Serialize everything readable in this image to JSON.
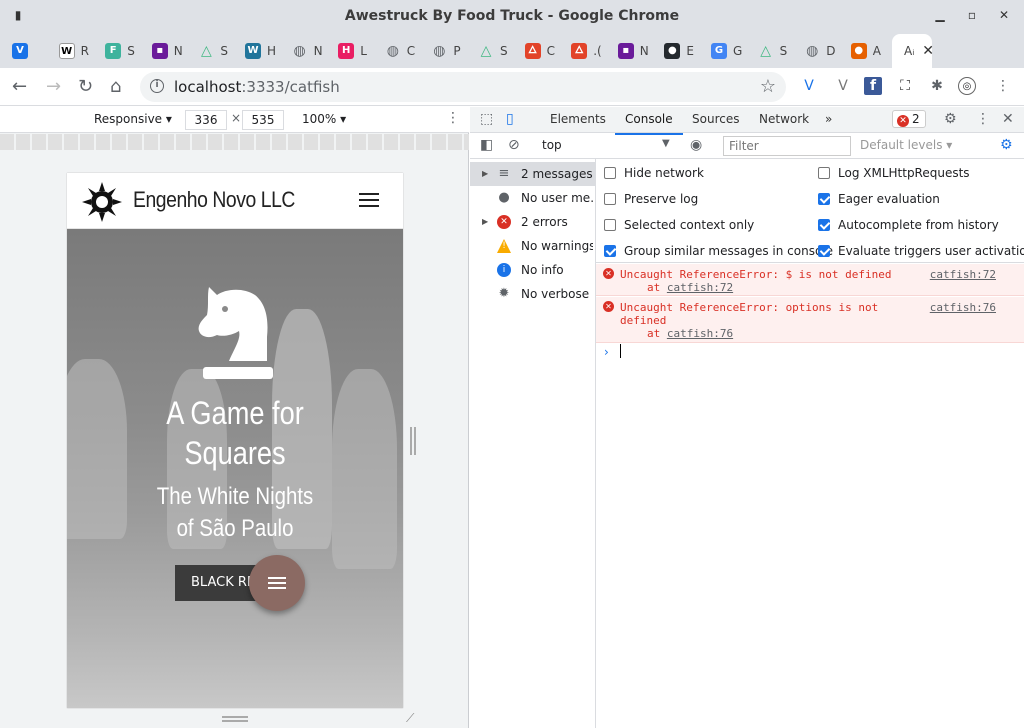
{
  "window": {
    "title": "Awestruck By Food Truck - Google Chrome",
    "minimize": "▁",
    "maximize": "▫",
    "close": "✕"
  },
  "tabs": [
    {
      "icon": "vivaldi-icon",
      "letter": "",
      "color": "#1a73e8"
    },
    {
      "icon": "wikipedia-icon",
      "letter": "R",
      "color": "#fff"
    },
    {
      "icon": "f-icon",
      "letter": "S",
      "color": "#3eb39d"
    },
    {
      "icon": "purple-icon",
      "letter": "N",
      "color": "#6a1b9a"
    },
    {
      "icon": "vue-icon",
      "letter": "S",
      "color": "#41b883"
    },
    {
      "icon": "wordpress-icon",
      "letter": "H",
      "color": "#21759b"
    },
    {
      "icon": "globe-icon",
      "letter": "N",
      "color": "#5f6368"
    },
    {
      "icon": "hexagon-icon",
      "letter": "L",
      "color": "#e91e63"
    },
    {
      "icon": "globe-icon",
      "letter": "C",
      "color": "#5f6368"
    },
    {
      "icon": "globe-icon",
      "letter": "P",
      "color": "#5f6368"
    },
    {
      "icon": "vue-icon",
      "letter": "S",
      "color": "#41b883"
    },
    {
      "icon": "gitlab-icon",
      "letter": "C",
      "color": "#e24329"
    },
    {
      "icon": "gitlab-icon",
      "letter": ".(",
      "color": "#e24329"
    },
    {
      "icon": "purple-icon",
      "letter": "N",
      "color": "#6a1b9a"
    },
    {
      "icon": "github-icon",
      "letter": "E",
      "color": "#24292e"
    },
    {
      "icon": "translate-icon",
      "letter": "G",
      "color": "#4285f4"
    },
    {
      "icon": "vue-icon",
      "letter": "S",
      "color": "#41b883"
    },
    {
      "icon": "globe-icon",
      "letter": "D",
      "color": "#5f6368"
    },
    {
      "icon": "firefox-icon",
      "letter": "A",
      "color": "#e66000"
    }
  ],
  "active_tab": {
    "label": "Aᵢ"
  },
  "omnibox": {
    "host": "localhost",
    "path": ":3333/catfish"
  },
  "emulation": {
    "mode": "Responsive ▾",
    "width": "336",
    "height": "535",
    "times": "×",
    "zoom": "100% ▾",
    "more": "⋮"
  },
  "site": {
    "brand": "Engenho Novo LLC",
    "hero_title_1": "A Game for",
    "hero_title_2": "Squares",
    "hero_sub_1": "The White Nights",
    "hero_sub_2": "of São Paulo",
    "cta": "BLACK RETURNS"
  },
  "devtools": {
    "tabs": [
      "Elements",
      "Console",
      "Sources",
      "Network"
    ],
    "more_tabs": "»",
    "error_count": "2",
    "context": "top",
    "filter_placeholder": "Filter",
    "levels": "Default levels ▾",
    "sidebar": [
      {
        "label": "2 messages",
        "icon": "list-icon",
        "expandable": true,
        "selected": true
      },
      {
        "label": "No user me...",
        "icon": "user-icon",
        "expandable": false,
        "selected": false
      },
      {
        "label": "2 errors",
        "icon": "error-icon",
        "expandable": true,
        "selected": false
      },
      {
        "label": "No warnings",
        "icon": "warning-icon",
        "expandable": false,
        "selected": false
      },
      {
        "label": "No info",
        "icon": "info-icon",
        "expandable": false,
        "selected": false
      },
      {
        "label": "No verbose",
        "icon": "bug-icon",
        "expandable": false,
        "selected": false
      }
    ],
    "settings": {
      "hide_network": {
        "label": "Hide network",
        "checked": false
      },
      "preserve_log": {
        "label": "Preserve log",
        "checked": false
      },
      "selected_context": {
        "label": "Selected context only",
        "checked": false
      },
      "group_similar": {
        "label": "Group similar messages in console",
        "checked": true
      },
      "log_xhr": {
        "label": "Log XMLHttpRequests",
        "checked": false
      },
      "eager_eval": {
        "label": "Eager evaluation",
        "checked": true
      },
      "autocomplete": {
        "label": "Autocomplete from history",
        "checked": true
      },
      "eval_triggers": {
        "label": "Evaluate triggers user activation",
        "checked": true
      }
    },
    "errors": [
      {
        "message": "Uncaught ReferenceError: $ is not defined",
        "at": "at",
        "link": "catfish:72",
        "source": "catfish:72"
      },
      {
        "message_1": "Uncaught ReferenceError: options is not",
        "message_2": "defined",
        "at": "at",
        "link": "catfish:76",
        "source": "catfish:76"
      }
    ],
    "prompt": "›"
  }
}
